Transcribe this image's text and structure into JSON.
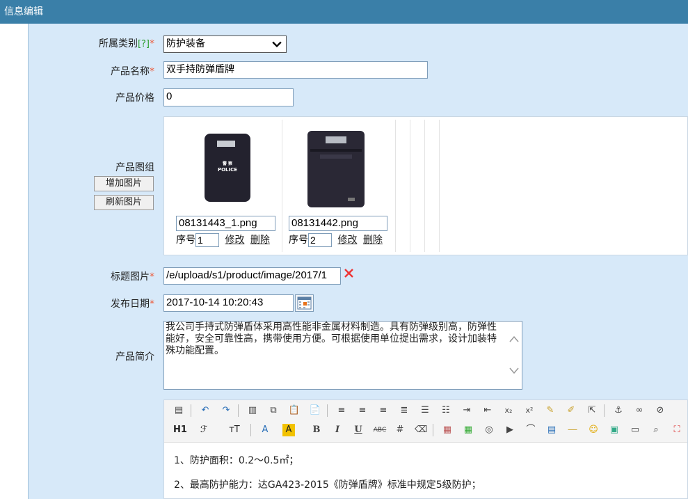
{
  "titlebar": {
    "title": "信息编辑"
  },
  "form": {
    "category": {
      "label": "所属类别",
      "help": "[?]",
      "required": "*",
      "value": "防护装备"
    },
    "name": {
      "label": "产品名称",
      "required": "*",
      "value": "双手持防弹盾牌"
    },
    "price": {
      "label": "产品价格",
      "value": "0"
    },
    "gallery": {
      "label": "产品图组",
      "add_button": "增加图片",
      "refresh_button": "刷新图片",
      "images": [
        {
          "filename": "08131443_1.png",
          "seq_label": "序号",
          "seq": "1",
          "edit": "修改",
          "delete": "删除"
        },
        {
          "filename": "08131442.png",
          "seq_label": "序号",
          "seq": "2",
          "edit": "修改",
          "delete": "删除"
        }
      ],
      "thumb_text": "警 察 POLICE"
    },
    "title_image": {
      "label": "标题图片",
      "required": "*",
      "value": "/e/upload/s1/product/image/2017/1"
    },
    "publish_date": {
      "label": "发布日期",
      "required": "*",
      "value": "2017-10-14 10:20:43"
    },
    "summary": {
      "label": "产品简介",
      "value": "我公司手持式防弹盾体采用高性能非金属材料制造。具有防弹级别高，防弹性能好，安全可靠性高，携带使用方便。可根据使用单位提出需求，设计加装特殊功能配置。"
    }
  },
  "editor": {
    "toolbar_row2": [
      "H1",
      "ℱ",
      "тT",
      "A",
      "A",
      "B",
      "I",
      "U",
      "ABC"
    ],
    "lines": [
      "1、防护面积：0.2～0.5㎡；",
      "2、最高防护能力：达GA423-2015《防弹盾牌》标准中规定5级防护；"
    ]
  },
  "colors": {
    "titlebar": "#3a7fa8",
    "panel": "#d7e9f9",
    "required": "#e53333",
    "help": "#2a9d2a"
  }
}
